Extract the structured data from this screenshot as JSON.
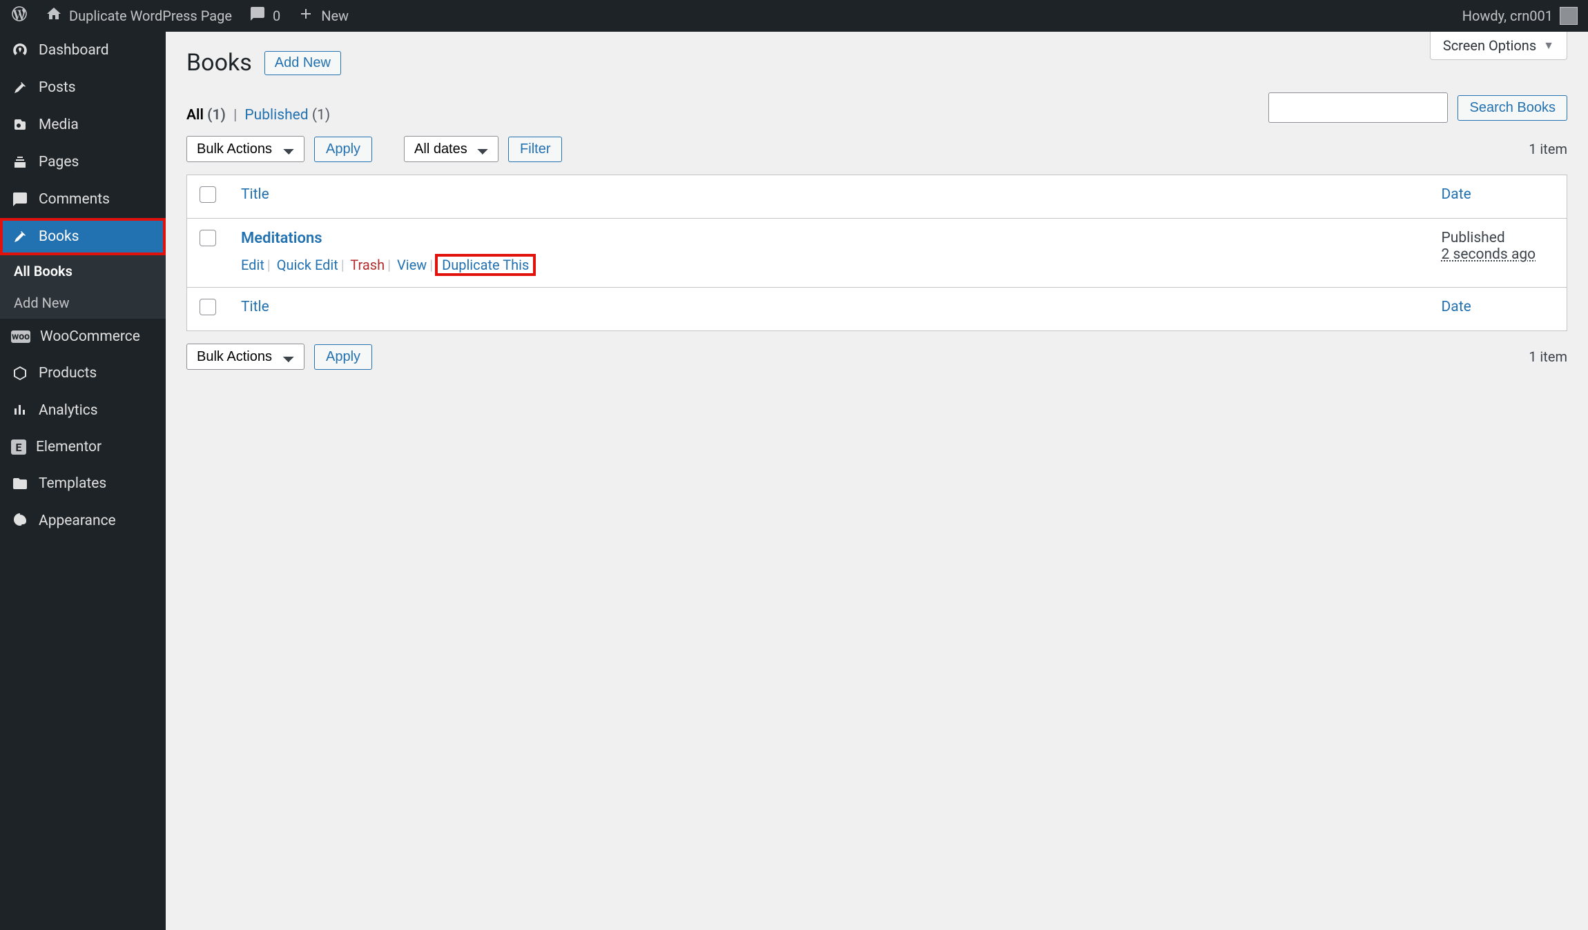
{
  "admin_bar": {
    "site_name": "Duplicate WordPress Page",
    "comments_count": "0",
    "new_label": "New",
    "howdy": "Howdy, crn001"
  },
  "sidebar": {
    "items": [
      {
        "icon": "dashboard",
        "label": "Dashboard"
      },
      {
        "icon": "pin",
        "label": "Posts"
      },
      {
        "icon": "media",
        "label": "Media"
      },
      {
        "icon": "pages",
        "label": "Pages"
      },
      {
        "icon": "comments",
        "label": "Comments"
      },
      {
        "icon": "pin",
        "label": "Books"
      },
      {
        "icon": "woo",
        "label": "WooCommerce"
      },
      {
        "icon": "products",
        "label": "Products"
      },
      {
        "icon": "analytics",
        "label": "Analytics"
      },
      {
        "icon": "elementor",
        "label": "Elementor"
      },
      {
        "icon": "templates",
        "label": "Templates"
      },
      {
        "icon": "appearance",
        "label": "Appearance"
      }
    ],
    "submenu": {
      "all_books": "All Books",
      "add_new": "Add New"
    }
  },
  "screen_options": "Screen Options",
  "page": {
    "title": "Books",
    "add_new": "Add New"
  },
  "filters": {
    "all_label": "All",
    "all_count": "(1)",
    "published_label": "Published",
    "published_count": "(1)"
  },
  "bulk_actions": "Bulk Actions",
  "apply": "Apply",
  "all_dates": "All dates",
  "filter": "Filter",
  "search": {
    "button": "Search Books"
  },
  "item_count": "1 item",
  "table": {
    "col_title": "Title",
    "col_date": "Date",
    "row": {
      "title": "Meditations",
      "edit": "Edit",
      "quick_edit": "Quick Edit",
      "trash": "Trash",
      "view": "View",
      "duplicate": "Duplicate This",
      "status": "Published",
      "ago": "2 seconds ago"
    }
  }
}
